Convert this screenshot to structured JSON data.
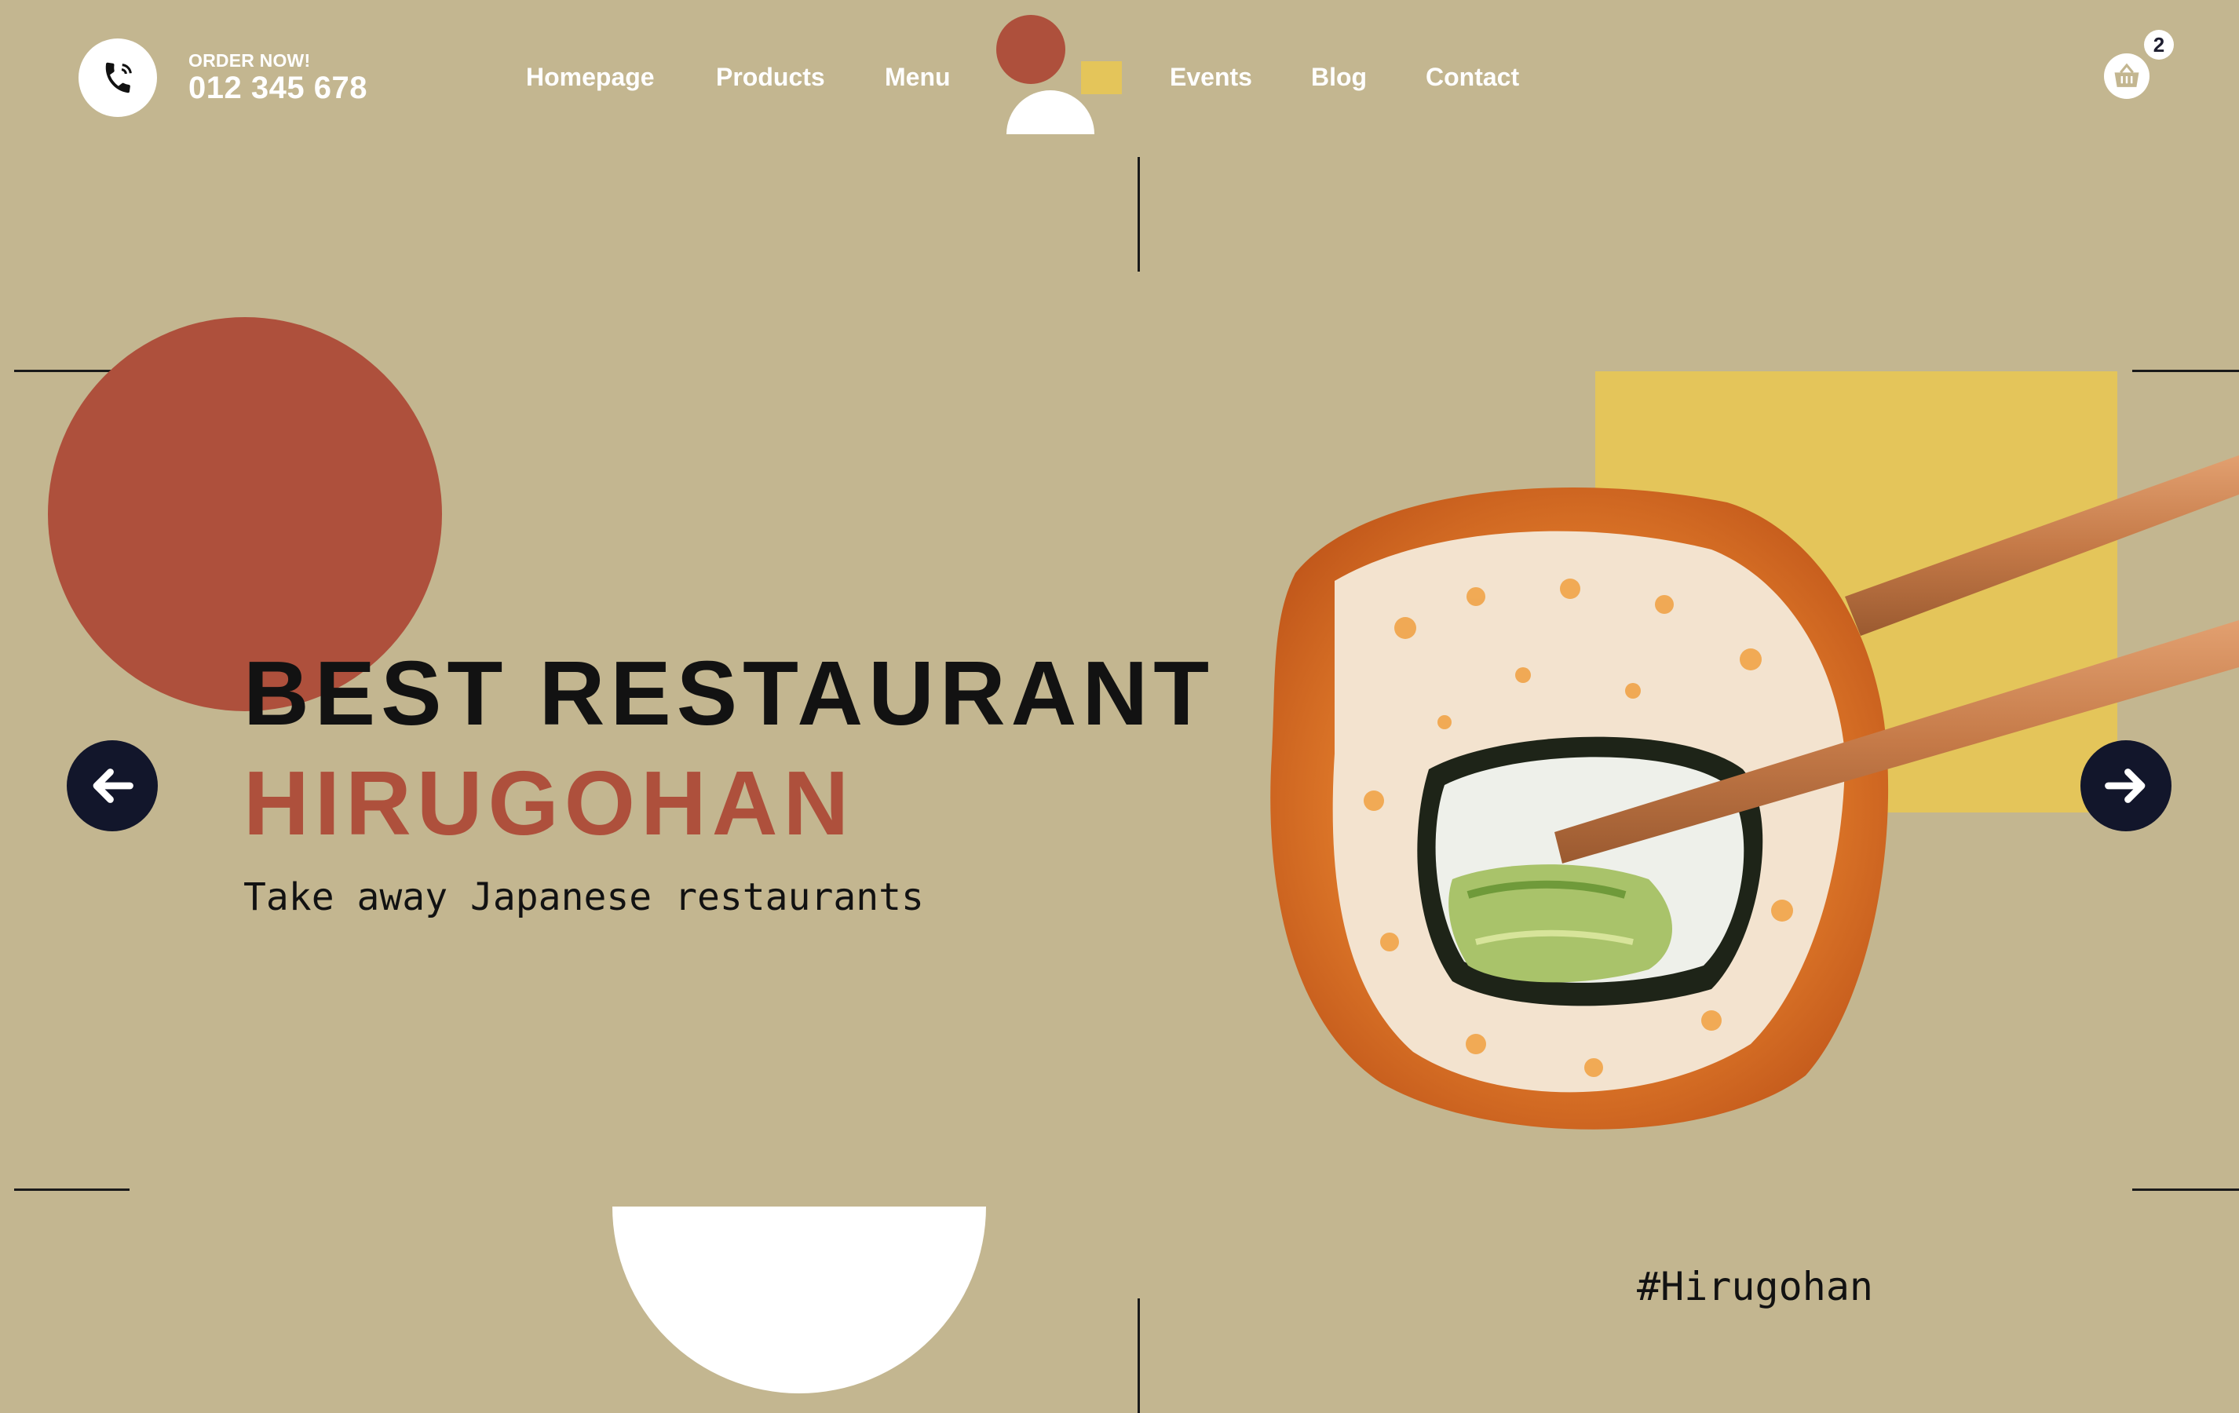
{
  "header": {
    "order_label": "ORDER NOW!",
    "order_number": "012 345 678",
    "nav": [
      {
        "label": "Homepage"
      },
      {
        "label": "Products"
      },
      {
        "label": "Menu"
      },
      {
        "label": "Events"
      },
      {
        "label": "Blog"
      },
      {
        "label": "Contact"
      }
    ],
    "cart_count": "2"
  },
  "hero": {
    "title_line1": "BEST RESTAURANT",
    "title_line2": "HIRUGOHAN",
    "subtitle": "Take away Japanese restaurants",
    "hashtag": "#Hirugohan"
  },
  "colors": {
    "background": "#c3b690",
    "accent_red": "#ae503c",
    "accent_yellow": "#e4c55a",
    "arrow_navy": "#12162b",
    "white": "#ffffff"
  },
  "icons": {
    "phone": "phone-icon",
    "cart": "basket-icon",
    "prev": "arrow-left-icon",
    "next": "arrow-right-icon"
  }
}
